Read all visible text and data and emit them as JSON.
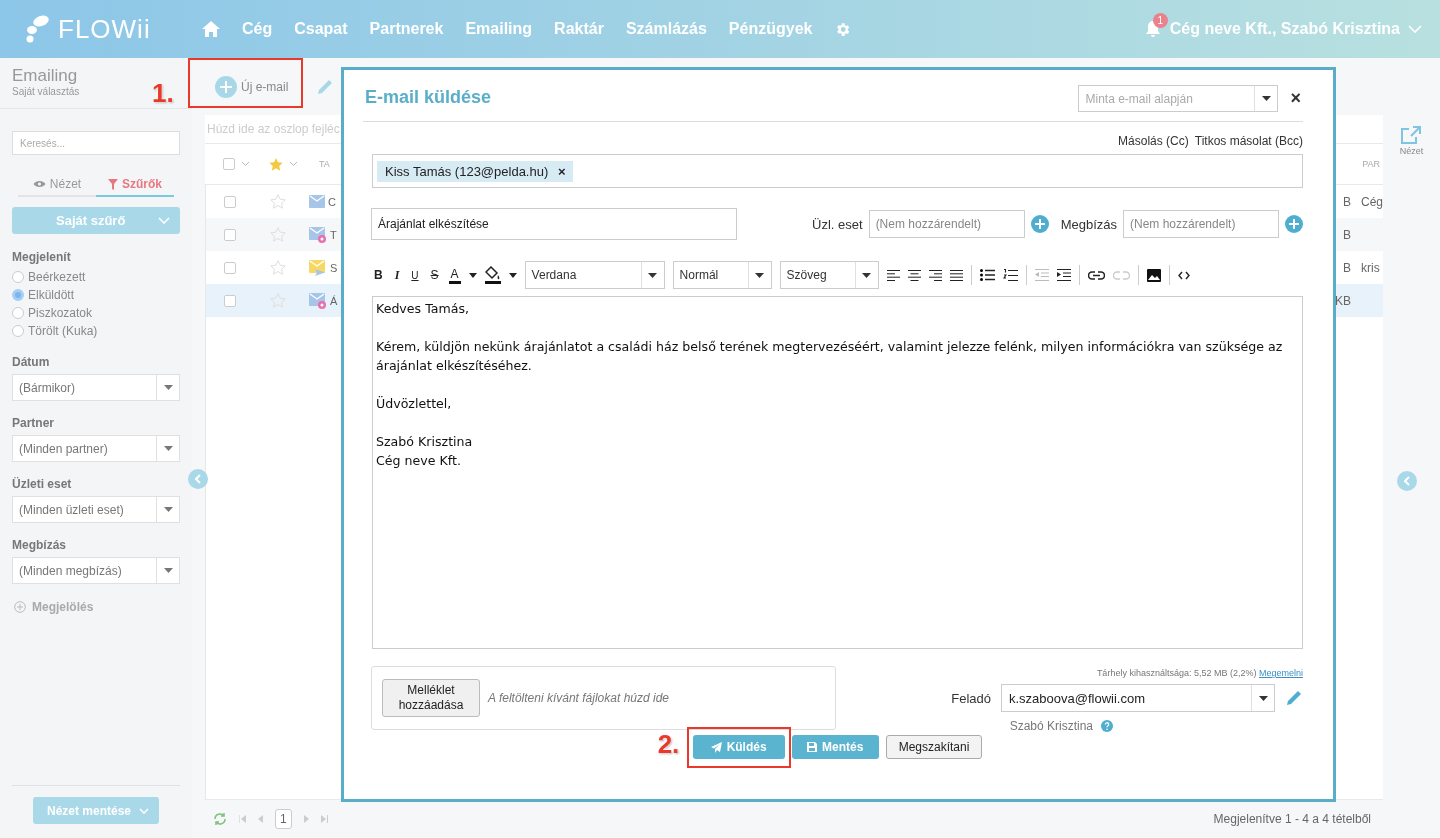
{
  "header": {
    "logo": "FLOWii",
    "nav": [
      {
        "label": "Cég",
        "selected": false
      },
      {
        "label": "Csapat",
        "selected": false
      },
      {
        "label": "Partnerek",
        "selected": false
      },
      {
        "label": "Emailing",
        "selected": false
      },
      {
        "label": "Raktár",
        "selected": false
      },
      {
        "label": "Számlázás",
        "selected": false
      },
      {
        "label": "Pénzügyek",
        "selected": false
      }
    ],
    "notification_count": "1",
    "user": "Cég neve Kft., Szabó Krisztina"
  },
  "page": {
    "title": "Emailing",
    "subtitle": "Saját választás",
    "new_email_button": "Új e-mail",
    "step_1": "1.",
    "step_2": "2."
  },
  "sidebar": {
    "search_placeholder": "Keresés...",
    "tabs": [
      {
        "kind": "view",
        "label": "Nézet",
        "selected": false
      },
      {
        "kind": "filter",
        "label": "Szűrők",
        "selected": true
      }
    ],
    "own_filter_button": "Saját szűrő",
    "show_label": "Megjelenít",
    "radios": [
      {
        "label": "Beérkezett",
        "selected": false
      },
      {
        "label": "Elküldött",
        "selected": true
      },
      {
        "label": "Piszkozatok",
        "selected": false
      },
      {
        "label": "Törölt (Kuka)",
        "selected": false
      }
    ],
    "filters": [
      {
        "label": "Dátum",
        "value": "(Bármikor)"
      },
      {
        "label": "Partner",
        "value": "(Minden partner)"
      },
      {
        "label": "Üzleti eset",
        "value": "(Minden üzleti eset)"
      },
      {
        "label": "Megbízás",
        "value": "(Minden megbízás)"
      }
    ],
    "mark_button": "Megjelölés",
    "save_view_button": "Nézet mentése"
  },
  "grid": {
    "select_all_checked": false,
    "group_hint": "Húzd ide az oszlop fejléc",
    "column_3": "TA",
    "column_right": "PAR",
    "rows": [
      {
        "kind": "received",
        "checked": false,
        "column_3": "C",
        "size": "B",
        "partner": "Cég",
        "selected": false
      },
      {
        "kind": "seen",
        "checked": false,
        "column_3": "T",
        "size": "B",
        "selected": false
      },
      {
        "kind": "sent",
        "checked": false,
        "column_3": "S",
        "size": "B",
        "partner": "kris",
        "selected": false
      },
      {
        "kind": "seen",
        "checked": false,
        "column_3": "Á",
        "size": "KB",
        "selected": true
      }
    ],
    "page": "1",
    "status": "Megjelenítve 1 - 4 a 4 tételből",
    "view_button": "Nézet"
  },
  "modal": {
    "title": "E-mail küldése",
    "template_placeholder": "Minta e-mail alapján",
    "close": "×",
    "cc": "Másolás (Cc)",
    "bcc": "Titkos másolat (Bcc)",
    "recipients": [
      {
        "label": "Kiss Tamás (123@pelda.hu)",
        "remove": "×"
      }
    ],
    "subject": "Árajánlat elkészítése",
    "business_case_label": "Üzl. eset",
    "business_case_placeholder": "(Nem hozzárendelt)",
    "order_label": "Megbízás",
    "order_placeholder": "(Nem hozzárendelt)",
    "format_buttons": [
      {
        "kind": "bold",
        "glyph": "B"
      },
      {
        "kind": "italic",
        "glyph": "I"
      },
      {
        "kind": "underline",
        "glyph": "U"
      },
      {
        "kind": "strike",
        "glyph": "S"
      },
      {
        "kind": "color",
        "glyph": "A"
      }
    ],
    "font": "Verdana",
    "size": "Normál",
    "block": "Szöveg",
    "body": [
      {
        "lines": [
          "Kedves Tamás,"
        ]
      },
      {
        "lines": [
          "Kérem, küldjön nekünk árajánlatot a családi ház belső terének megtervezéséért, valamint jelezze felénk, milyen információkra van szüksége az árajánlat elkészítéséhez."
        ]
      },
      {
        "lines": [
          "Üdvözlettel,"
        ]
      },
      {
        "lines": [
          "Szabó Krisztina",
          "Cég neve Kft."
        ]
      }
    ],
    "attach_button": "Melléklet hozzáadása",
    "drop_hint": "A feltölteni kívánt fájlokat húzd ide",
    "storage": "Tárhely kihasználtsága: 5,52 MB (2,2%)",
    "storage_link": "Megemelni",
    "sender_label": "Feladó",
    "sender": "k.szaboova@flowii.com",
    "sender_name": "Szabó Krisztina",
    "buttons": [
      {
        "kind": "send",
        "label": "Küldés"
      },
      {
        "kind": "save",
        "label": "Mentés"
      },
      {
        "kind": "cancel",
        "label": "Megszakítani"
      }
    ]
  }
}
